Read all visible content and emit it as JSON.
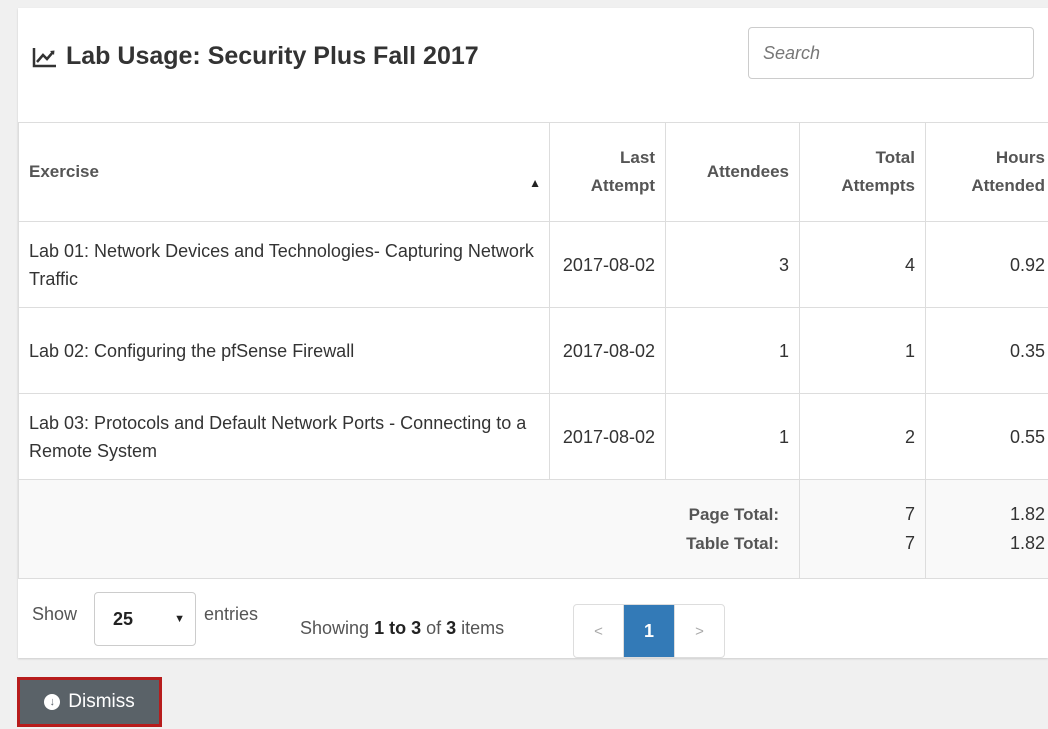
{
  "header": {
    "title": "Lab Usage: Security Plus Fall 2017",
    "search_placeholder": "Search"
  },
  "table": {
    "columns": {
      "exercise": "Exercise",
      "last_attempt": "Last Attempt",
      "attendees": "Attendees",
      "total_attempts": "Total Attempts",
      "hours_attended": "Hours Attended"
    },
    "rows": [
      {
        "exercise": "Lab 01: Network Devices and Technologies- Capturing Network Traffic",
        "last_attempt": "2017-08-02",
        "attendees": "3",
        "total_attempts": "4",
        "hours_attended": "0.92"
      },
      {
        "exercise": "Lab 02: Configuring the pfSense Firewall",
        "last_attempt": "2017-08-02",
        "attendees": "1",
        "total_attempts": "1",
        "hours_attended": "0.35"
      },
      {
        "exercise": "Lab 03: Protocols and Default Network Ports - Connecting to a Remote System",
        "last_attempt": "2017-08-02",
        "attendees": "1",
        "total_attempts": "2",
        "hours_attended": "0.55"
      }
    ],
    "totals": {
      "page_label": "Page Total:",
      "table_label": "Table Total:",
      "page_attempts": "7",
      "table_attempts": "7",
      "page_hours": "1.82",
      "table_hours": "1.82"
    }
  },
  "footer": {
    "show_label": "Show",
    "entries_value": "25",
    "entries_label": "entries",
    "showing_prefix": "Showing",
    "showing_range": "1 to 3",
    "showing_of": "of",
    "showing_count": "3",
    "showing_suffix": "items",
    "pager_prev": "<",
    "pager_current": "1",
    "pager_next": ">"
  },
  "actions": {
    "dismiss_label": "Dismiss"
  },
  "colors": {
    "accent": "#337ab7",
    "dismiss_bg": "#5a6268",
    "dismiss_border": "#b71c1c"
  },
  "icons": {
    "title": "line-chart-icon",
    "dismiss": "arrow-circle-down-icon"
  }
}
